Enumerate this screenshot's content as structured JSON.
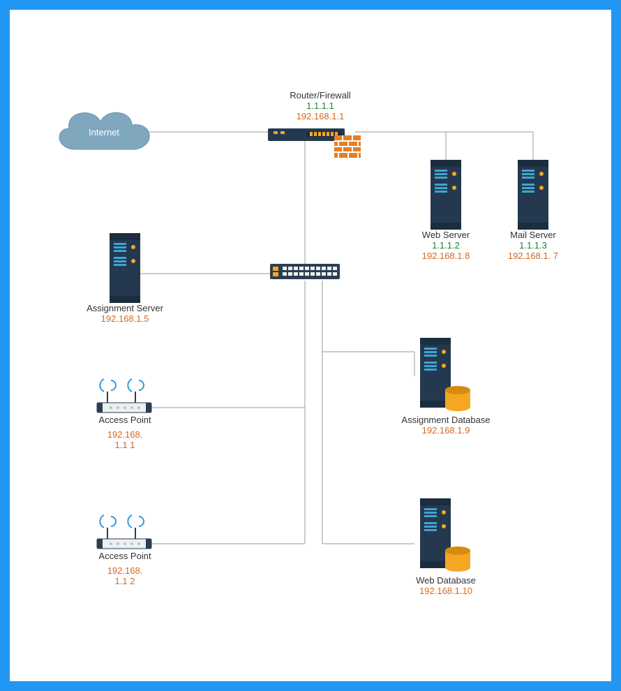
{
  "cloud": {
    "label": "Internet"
  },
  "router": {
    "title": "Router/Firewall",
    "public_ip": "1.1.1.1",
    "lan_ip": "192.168.1.1"
  },
  "web_server": {
    "title": "Web Server",
    "public_ip": "1.1.1.2",
    "lan_ip": "192.168.1.8"
  },
  "mail_server": {
    "title": "Mail Server",
    "public_ip": "1.1.1.3",
    "lan_ip": "192.168.1.   7"
  },
  "assignment_server": {
    "title": "Assignment Server",
    "lan_ip": "192.168.1.5"
  },
  "assignment_db": {
    "title": "Assignment Database",
    "lan_ip": "192.168.1.9"
  },
  "web_db": {
    "title": "Web Database",
    "lan_ip": "192.168.1.10"
  },
  "ap1": {
    "title": "Access Point",
    "lan_ip_line1": "192.168.",
    "lan_ip_line2": "1.1   1"
  },
  "ap2": {
    "title": "Access Point",
    "lan_ip_line1": "192.168.",
    "lan_ip_line2": "1.1    2"
  }
}
